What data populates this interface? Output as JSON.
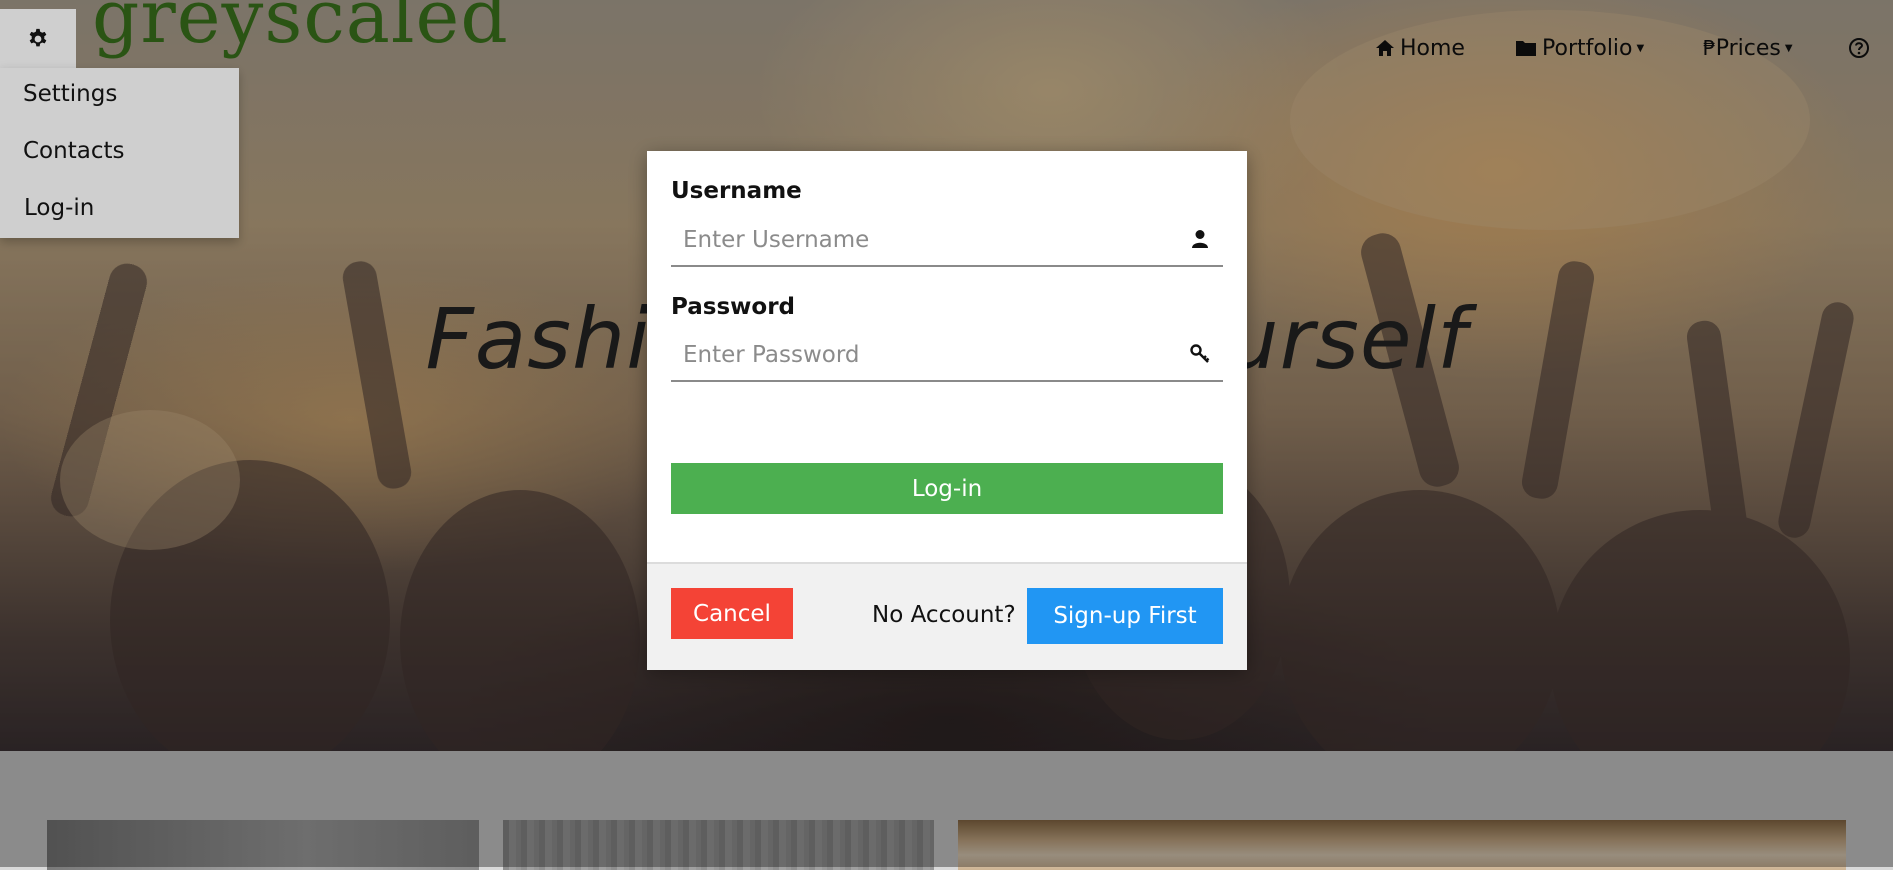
{
  "brand": {
    "logo_text": "greyscaled",
    "logo_color": "#3f7e1e"
  },
  "hero": {
    "tagline": "Fashion Yourself",
    "tagline_visible_left": "Fashio",
    "tagline_visible_right": "ourself"
  },
  "settings_menu": {
    "icon": "gear-icon",
    "items": [
      {
        "label": "Settings"
      },
      {
        "label": "Contacts"
      },
      {
        "label": "Log-in"
      }
    ]
  },
  "nav": {
    "items": [
      {
        "label": "Home",
        "icon": "home-icon"
      },
      {
        "label": "Portfolio",
        "icon": "folder-icon",
        "has_dropdown": true
      },
      {
        "label": "Prices",
        "icon": "peso-icon",
        "icon_glyph": "₱",
        "has_dropdown": true
      },
      {
        "label": "",
        "icon": "help-icon"
      }
    ]
  },
  "login_modal": {
    "username_label": "Username",
    "username_placeholder": "Enter Username",
    "username_icon": "user-icon",
    "password_label": "Password",
    "password_placeholder": "Enter Password",
    "password_icon": "key-icon",
    "login_label": "Log-in",
    "cancel_label": "Cancel",
    "no_account_text": "No Account?",
    "signup_label": "Sign-up First"
  },
  "colors": {
    "login_button": "#4caf50",
    "cancel_button": "#f44336",
    "signup_button": "#2196f3"
  }
}
